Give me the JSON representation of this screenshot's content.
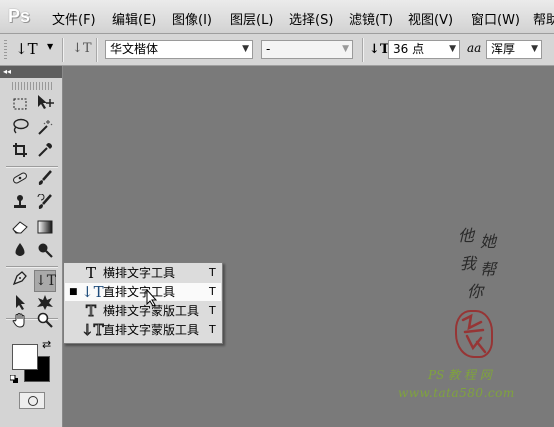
{
  "app": {
    "logo": "Ps"
  },
  "menu": [
    "文件(F)",
    "编辑(E)",
    "图像(I)",
    "图层(L)",
    "选择(S)",
    "滤镜(T)",
    "视图(V)",
    "窗口(W)",
    "帮助"
  ],
  "options": {
    "tool_glyph": "↓T",
    "font_family": "华文楷体",
    "font_style": "-",
    "size_glyph": "↓T",
    "font_size": "36 点",
    "aa_glyph": "aa",
    "anti_alias": "浑厚"
  },
  "toolbox": {
    "collapse": "◂◂"
  },
  "flyout": {
    "items": [
      {
        "icon": "T",
        "label": "横排文字工具",
        "key": "T",
        "selected": false
      },
      {
        "icon": "↓T",
        "label": "直排文字工具",
        "key": "T",
        "selected": true
      },
      {
        "icon": "T",
        "label": "横排文字蒙版工具",
        "key": "T",
        "selected": false
      },
      {
        "icon": "↓T",
        "label": "直排文字蒙版工具",
        "key": "T",
        "selected": false
      }
    ],
    "bullet": "■"
  },
  "watermark": {
    "chars": [
      "他",
      "她",
      "我",
      "帮",
      "你"
    ],
    "brand": "PS 教 程 网",
    "url": "www.tata580.com"
  },
  "colors": {
    "foreground": "#ffffff",
    "background": "#000000",
    "canvas": "#7a7a7a",
    "seal": "#9e2424",
    "watermark_green": "#7fa33d"
  }
}
